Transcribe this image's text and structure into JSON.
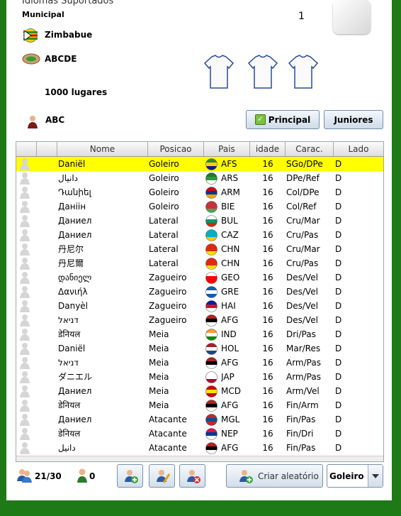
{
  "header": {
    "languages_label": "Idiomas Suportados",
    "municipal_label": "Municipal",
    "country": "Zimbabue",
    "stadium": "ABCDE",
    "capacity": "1000 lugares",
    "manager": "ABC",
    "number": "1"
  },
  "buttons": {
    "principal": "Principal",
    "juniores": "Juniores",
    "random": "Criar aleatório",
    "position_select": "Goleiro"
  },
  "table": {
    "headers": [
      "",
      "",
      "Nome",
      "Posicao",
      "Pais",
      "idade",
      "Carac.",
      "Lado"
    ],
    "rows": [
      {
        "name": "Daniël",
        "pos": "Goleiro",
        "country": "AFS",
        "age": "16",
        "carac": "SGo/DPe",
        "side": "D",
        "flag": [
          "#2f8a3a",
          "#ffd200",
          "#0b1e8c"
        ]
      },
      {
        "name": "دانيال",
        "pos": "Goleiro",
        "country": "ARS",
        "age": "16",
        "carac": "DPe/Ref",
        "side": "D",
        "flag": [
          "#1c7a2c",
          "#2a9a3a",
          "#ffffff"
        ]
      },
      {
        "name": "Դանիել",
        "pos": "Goleiro",
        "country": "ARM",
        "age": "16",
        "carac": "Col/DPe",
        "side": "D",
        "flag": [
          "#d90012",
          "#0033a0",
          "#f2a800"
        ]
      },
      {
        "name": "Даніін",
        "pos": "Goleiro",
        "country": "BIE",
        "age": "16",
        "carac": "Col/Ref",
        "side": "D",
        "flag": [
          "#c8313e",
          "#c8313e",
          "#4aa657"
        ]
      },
      {
        "name": "Даниел",
        "pos": "Lateral",
        "country": "BUL",
        "age": "16",
        "carac": "Cru/Mar",
        "side": "D",
        "flag": [
          "#ffffff",
          "#00966e",
          "#d62612"
        ]
      },
      {
        "name": "Даниел",
        "pos": "Lateral",
        "country": "CAZ",
        "age": "16",
        "carac": "Cru/Pas",
        "side": "D",
        "flag": [
          "#00afca",
          "#00afca",
          "#fec50c"
        ]
      },
      {
        "name": "丹尼尔",
        "pos": "Lateral",
        "country": "CHN",
        "age": "16",
        "carac": "Cru/Mar",
        "side": "D",
        "flag": [
          "#de2910",
          "#de2910",
          "#ffde00"
        ]
      },
      {
        "name": "丹尼爾",
        "pos": "Lateral",
        "country": "CHN",
        "age": "16",
        "carac": "Cru/Pas",
        "side": "D",
        "flag": [
          "#de2910",
          "#de2910",
          "#ffde00"
        ]
      },
      {
        "name": "დანიელ",
        "pos": "Zagueiro",
        "country": "GEO",
        "age": "16",
        "carac": "Des/Vel",
        "side": "D",
        "flag": [
          "#ffffff",
          "#ff0000",
          "#ff0000"
        ]
      },
      {
        "name": "Δανιήλ",
        "pos": "Zagueiro",
        "country": "GRE",
        "age": "16",
        "carac": "Des/Vel",
        "side": "D",
        "flag": [
          "#0d5eaf",
          "#ffffff",
          "#0d5eaf"
        ]
      },
      {
        "name": "Danyèl",
        "pos": "Zagueiro",
        "country": "HAI",
        "age": "16",
        "carac": "Des/Vel",
        "side": "D",
        "flag": [
          "#00209f",
          "#d21034",
          "#ffffff"
        ]
      },
      {
        "name": "דניאל",
        "pos": "Zagueiro",
        "country": "AFG",
        "age": "16",
        "carac": "Des/Vel",
        "side": "D",
        "flag": [
          "#b22222",
          "#000000",
          "#ffffff"
        ]
      },
      {
        "name": "डेनियल",
        "pos": "Meia",
        "country": "IND",
        "age": "16",
        "carac": "Dri/Pas",
        "side": "D",
        "flag": [
          "#ff9933",
          "#ffffff",
          "#138808"
        ]
      },
      {
        "name": "Daniël",
        "pos": "Meia",
        "country": "HOL",
        "age": "16",
        "carac": "Mar/Res",
        "side": "D",
        "flag": [
          "#ae1c28",
          "#ffffff",
          "#21468b"
        ]
      },
      {
        "name": "דניאל",
        "pos": "Meia",
        "country": "AFG",
        "age": "16",
        "carac": "Arm/Pas",
        "side": "D",
        "flag": [
          "#b22222",
          "#000000",
          "#ffffff"
        ]
      },
      {
        "name": "ダニエル",
        "pos": "Meia",
        "country": "JAP",
        "age": "16",
        "carac": "Arm/Pas",
        "side": "D",
        "flag": [
          "#ffffff",
          "#ffffff",
          "#bc002d"
        ]
      },
      {
        "name": "Даниел",
        "pos": "Meia",
        "country": "MCD",
        "age": "16",
        "carac": "Arm/Vel",
        "side": "D",
        "flag": [
          "#d20000",
          "#ffe600",
          "#d20000"
        ]
      },
      {
        "name": "डेनियल",
        "pos": "Meia",
        "country": "AFG",
        "age": "16",
        "carac": "Fin/Arm",
        "side": "D",
        "flag": [
          "#b22222",
          "#000000",
          "#ffffff"
        ]
      },
      {
        "name": "Даниел",
        "pos": "Atacante",
        "country": "MGL",
        "age": "16",
        "carac": "Fin/Pas",
        "side": "D",
        "flag": [
          "#c4272f",
          "#015197",
          "#c4272f"
        ]
      },
      {
        "name": "डेनियल",
        "pos": "Atacante",
        "country": "NEP",
        "age": "16",
        "carac": "Fin/Dri",
        "side": "D",
        "flag": [
          "#dc143c",
          "#003893",
          "#ffffff"
        ]
      },
      {
        "name": "دانیل",
        "pos": "Atacante",
        "country": "AFG",
        "age": "16",
        "carac": "Fin/Pas",
        "side": "D",
        "flag": [
          "#b22222",
          "#000000",
          "#ffffff"
        ]
      }
    ]
  },
  "footer": {
    "players_count": "21/30",
    "juniors_count": "0"
  }
}
